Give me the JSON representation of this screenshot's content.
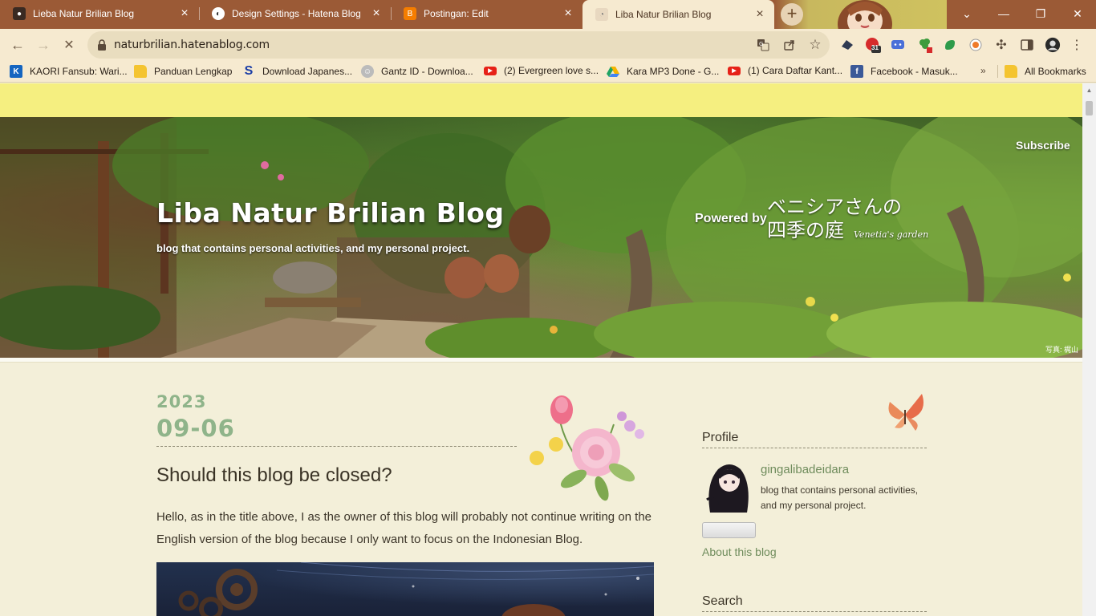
{
  "browser": {
    "tabs": [
      {
        "title": "Lieba Natur Brilian Blog"
      },
      {
        "title": "Design Settings - Hatena Blog"
      },
      {
        "title": "Postingan: Edit"
      },
      {
        "title": "Liba Natur Brilian Blog",
        "active": true
      }
    ],
    "new_tab_label": "+",
    "window_controls": {
      "dropdown": "⌄",
      "minimize": "—",
      "restore": "❐",
      "close": "✕"
    },
    "url": "naturbrilian.hatenablog.com",
    "extension_badge": "31",
    "bookmarks": [
      {
        "label": "KAORI Fansub: Wari...",
        "icon": "kaori-icon",
        "color": "#1565c0"
      },
      {
        "label": "Panduan Lengkap",
        "icon": "folder-icon",
        "color": "#f4c430"
      },
      {
        "label": "Download Japanes...",
        "icon": "s-logo-icon",
        "color": "#1a3da6"
      },
      {
        "label": "Gantz ID - Downloa...",
        "icon": "gantz-icon",
        "color": "#888888"
      },
      {
        "label": "(2) Evergreen love s...",
        "icon": "youtube-icon",
        "color": "#e62117"
      },
      {
        "label": "Kara MP3 Done - G...",
        "icon": "google-drive-icon",
        "color": "#1fa463"
      },
      {
        "label": "(1) Cara Daftar Kant...",
        "icon": "youtube-icon",
        "color": "#e62117"
      },
      {
        "label": "Facebook - Masuk...",
        "icon": "facebook-icon",
        "color": "#3b5998"
      }
    ],
    "bookmarks_overflow": "»",
    "all_bookmarks": "All Bookmarks"
  },
  "page": {
    "subscribe": "Subscribe",
    "blog_title": "Liba Natur Brilian Blog",
    "blog_description": "blog that contains personal activities, and my personal project.",
    "powered_by": "Powered by",
    "powered_by_jp_line1": "ベニシアさんの",
    "powered_by_jp_line2": "四季の庭",
    "powered_by_en": "Venetia's garden",
    "photo_credit": "写真: 梶山",
    "post": {
      "year": "2023",
      "month_day": "09-06",
      "title": "Should this blog be closed?",
      "body": "Hello, as in the title above, I as the owner of this blog will probably not continue writing on the English version of the blog because I only want to focus on the Indonesian Blog."
    },
    "sidebar": {
      "profile_heading": "Profile",
      "profile_name": "gingalibadeidara",
      "profile_description": "blog that contains personal activities, and my personal project.",
      "about_link": "About this blog",
      "search_heading": "Search"
    }
  },
  "colors": {
    "tab_strip": "#9b5a36",
    "toolbar": "#f6ead0",
    "top_strip": "#f5ef80",
    "page_bg": "#f3efd9",
    "date_green": "#8fb48a",
    "link_green": "#6f8c5c"
  }
}
